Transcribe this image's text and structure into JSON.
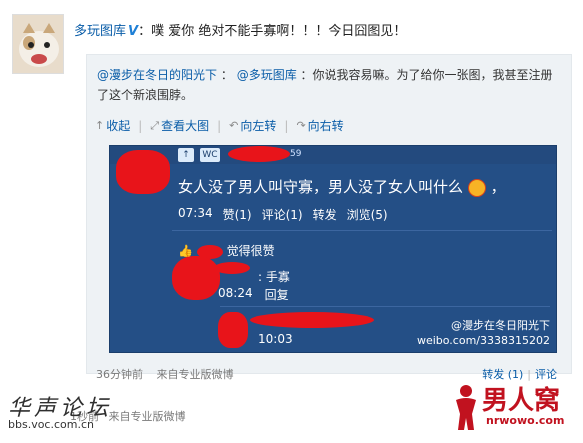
{
  "post": {
    "author": "多玩图库",
    "verified_mark": "V",
    "text": "：噗 爱你 绝对不能手寡啊！！！今日囧图见！"
  },
  "repost": {
    "mention": "@漫步在冬日的阳光下",
    "reply_to": "@多玩图库",
    "text": "：你说我容易嘛。为了给你一张图，我甚至注册了这个新浪围脖。",
    "actions": [
      "收起",
      "查看大图",
      "向左转",
      "向右转"
    ]
  },
  "screenshot": {
    "badges": [
      "↑",
      "WC"
    ],
    "small_count": "59",
    "message": "女人没了男人叫守寡，男人没了女人叫什么",
    "time1": "07:34",
    "counts": [
      "赞(1)",
      "评论(1)",
      "转发",
      "浏览(5)"
    ],
    "like_text": "觉得很赞",
    "reply_text": "手寡",
    "time2": "08:24",
    "reply_btn": "回复",
    "time3": "10:03",
    "caption": "@漫步在冬日阳光下",
    "url": "weibo.com/3338315202"
  },
  "footer": {
    "time": "36分钟前",
    "source": "来自专业版微博",
    "repost": "转发 (1)",
    "comment": "评论"
  },
  "footer2": {
    "time": "1秒前",
    "source": "来自专业版微博"
  },
  "watermark": {
    "forum": "华声论坛",
    "forum_url": "bbs.voc.com.cn"
  },
  "logo": {
    "name": "男人窝",
    "url": "nrwowo.com"
  },
  "colors": {
    "link": "#0a5da8",
    "panel": "#244f86",
    "redact": "#e8141a"
  }
}
